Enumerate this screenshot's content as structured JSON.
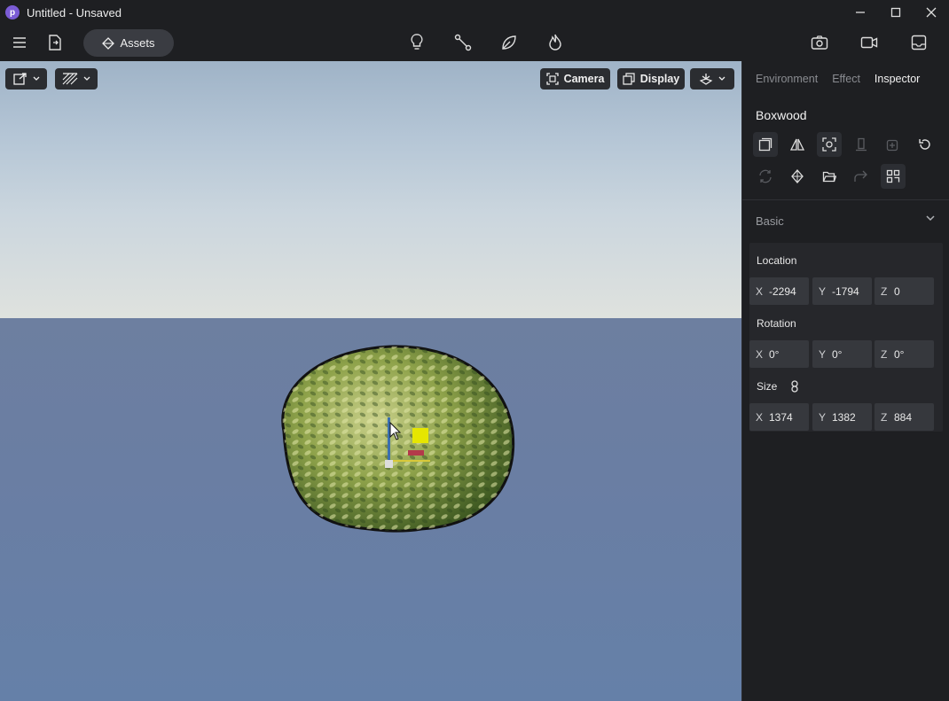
{
  "window": {
    "title": "Untitled - Unsaved",
    "logo_letter": "p"
  },
  "toolbar": {
    "assets_label": "Assets"
  },
  "viewport": {
    "camera_label": "Camera",
    "display_label": "Display"
  },
  "panel": {
    "tabs": [
      "Environment",
      "Effect",
      "Inspector"
    ],
    "active_tab": "Inspector",
    "object_name": "Boxwood",
    "section_title": "Basic",
    "location": {
      "label": "Location",
      "x": "-2294",
      "y": "-1794",
      "z": "0"
    },
    "rotation": {
      "label": "Rotation",
      "x": "0°",
      "y": "0°",
      "z": "0°"
    },
    "size": {
      "label": "Size",
      "x": "1374",
      "y": "1382",
      "z": "884"
    },
    "axis_labels": {
      "x": "X",
      "y": "Y",
      "z": "Z"
    }
  },
  "colors": {
    "accent": "#7b5cd6",
    "panel_bg": "#1e1f22",
    "field_bg": "#36383d",
    "gizmo_yellow": "#e6e600"
  }
}
